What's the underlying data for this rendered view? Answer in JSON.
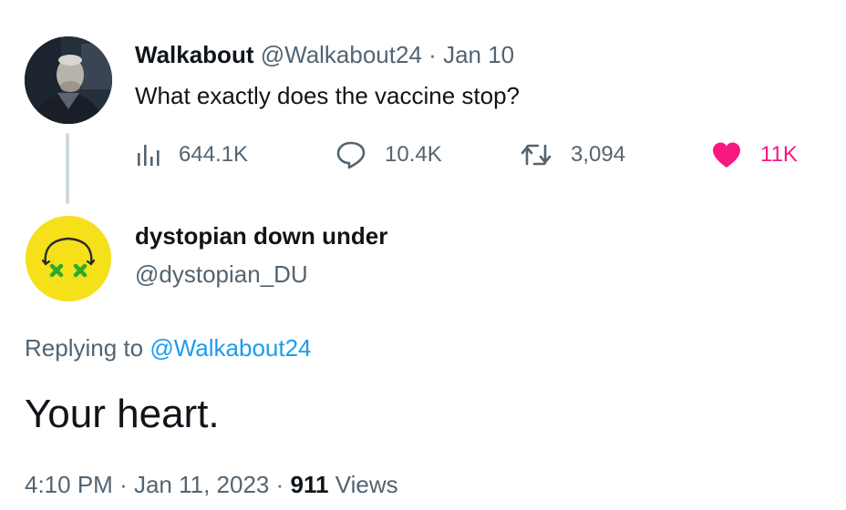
{
  "original_tweet": {
    "author_name": "Walkabout",
    "handle": "@Walkabout24",
    "separator": "·",
    "date": "Jan 10",
    "text": "What exactly does the vaccine stop?",
    "metrics": {
      "views": "644.1K",
      "replies": "10.4K",
      "retweets": "3,094",
      "likes": "11K"
    },
    "avatar_icon": "profile-photo-man"
  },
  "reply_tweet": {
    "author_name": "dystopian down under",
    "handle": "@dystopian_DU",
    "replying_prefix": "Replying to",
    "replying_to": "@Walkabout24",
    "text": "Your heart.",
    "timestamp_time": "4:10 PM",
    "timestamp_date": "Jan 11, 2023",
    "separator": "·",
    "views_count": "911",
    "views_label": "Views",
    "avatar_icon": "dizzy-face-emoji"
  },
  "colors": {
    "text_primary": "#0f1419",
    "text_secondary": "#536471",
    "link": "#1d9bf0",
    "like": "#f91880",
    "thread_line": "#cfd9de",
    "avatar_yellow": "#f5e019",
    "avatar_green": "#2bab2b"
  }
}
